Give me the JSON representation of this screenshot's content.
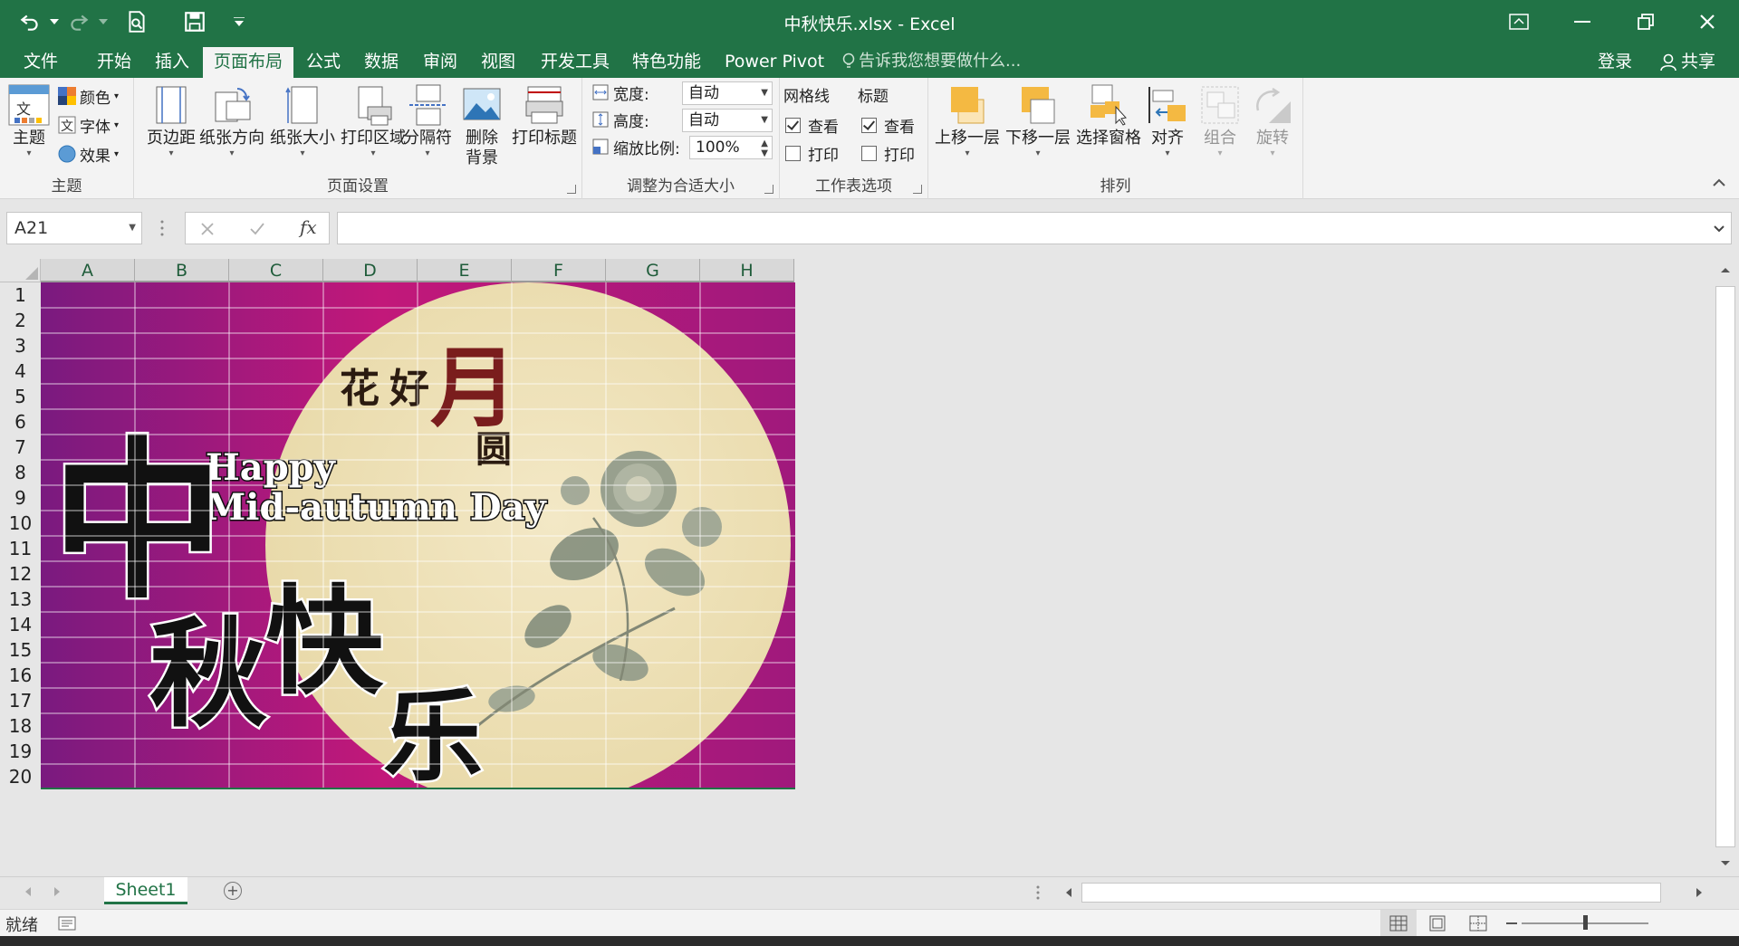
{
  "window": {
    "title": "中秋快乐.xlsx - Excel"
  },
  "menu": {
    "tabs": [
      "文件",
      "开始",
      "插入",
      "页面布局",
      "公式",
      "数据",
      "审阅",
      "视图",
      "开发工具",
      "特色功能",
      "Power Pivot"
    ],
    "active_tab": "页面布局",
    "tell_me": "告诉我您想要做什么...",
    "sign_in": "登录",
    "share": "共享"
  },
  "ribbon": {
    "themes": {
      "group_label": "主题",
      "theme": "主题",
      "colors": "颜色",
      "fonts": "字体",
      "effects": "效果"
    },
    "page_setup": {
      "group_label": "页面设置",
      "margins": "页边距",
      "orientation": "纸张方向",
      "size": "纸张大小",
      "print_area": "打印区域",
      "breaks": "分隔符",
      "delete_bg_1": "删除",
      "delete_bg_2": "背景",
      "print_titles": "打印标题"
    },
    "scale_to_fit": {
      "group_label": "调整为合适大小",
      "width_label": "宽度:",
      "width_value": "自动",
      "height_label": "高度:",
      "height_value": "自动",
      "scale_label": "缩放比例:",
      "scale_value": "100%"
    },
    "sheet_options": {
      "group_label": "工作表选项",
      "gridlines": "网格线",
      "headings": "标题",
      "view": "查看",
      "print": "打印",
      "gridlines_view": true,
      "gridlines_print": false,
      "headings_view": true,
      "headings_print": false
    },
    "arrange": {
      "group_label": "排列",
      "bring_forward": "上移一层",
      "send_backward": "下移一层",
      "selection_pane": "选择窗格",
      "align": "对齐",
      "group": "组合",
      "rotate": "旋转"
    }
  },
  "formula_bar": {
    "name_box": "A21",
    "formula": ""
  },
  "grid": {
    "columns": [
      "A",
      "B",
      "C",
      "D",
      "E",
      "F",
      "G",
      "H"
    ],
    "rows": [
      "1",
      "2",
      "3",
      "4",
      "5",
      "6",
      "7",
      "8",
      "9",
      "10",
      "11",
      "12",
      "13",
      "14",
      "15",
      "16",
      "17",
      "18",
      "19",
      "20"
    ]
  },
  "image": {
    "title_chars": "中秋快乐",
    "english_line1": "Happy",
    "english_line2": "Mid-autumn Day",
    "poem": "花好月圆",
    "background_color": "#c2187a",
    "moon_color": "#efe3bd"
  },
  "sheets": {
    "tabs": [
      "Sheet1"
    ],
    "active": "Sheet1"
  },
  "status": {
    "ready": "就绪"
  }
}
